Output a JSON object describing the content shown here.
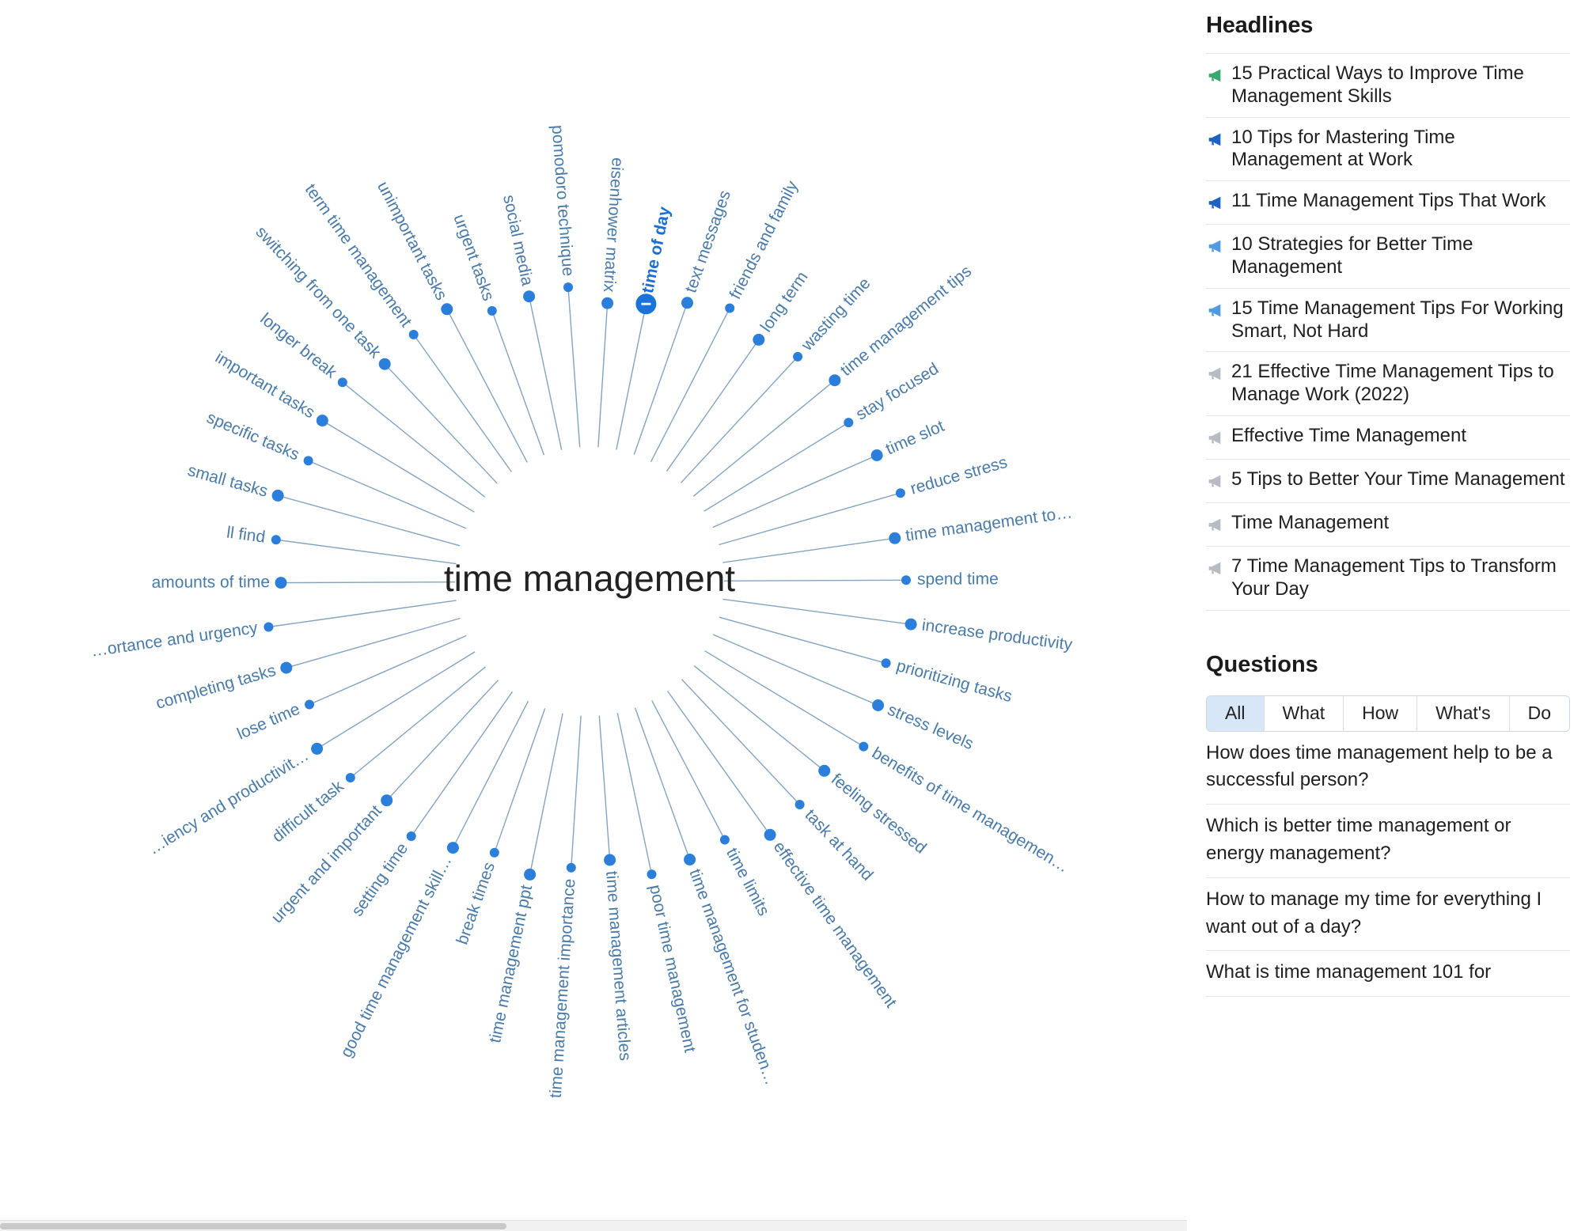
{
  "graph": {
    "center_label": "time management",
    "active_node": "time of day",
    "nodes": [
      {
        "label": "time of day",
        "angle": -77,
        "bold": true
      },
      {
        "label": "text messages",
        "angle": -65
      },
      {
        "label": "friends and family",
        "angle": -54
      },
      {
        "label": "long term",
        "angle": -44
      },
      {
        "label": "wasting time",
        "angle": -35
      },
      {
        "label": "time management tips",
        "angle": -26
      },
      {
        "label": "stay focused",
        "angle": -17
      },
      {
        "label": "time slot",
        "angle": -8
      },
      {
        "label": "reduce stress",
        "angle": 0
      },
      {
        "label": "time management to…",
        "angle": 8
      },
      {
        "label": "spend time",
        "angle": 17
      },
      {
        "label": "increase productivity",
        "angle": 26
      },
      {
        "label": "prioritizing tasks",
        "angle": 35
      },
      {
        "label": "stress levels",
        "angle": 44
      },
      {
        "label": "benefits of time managemen…",
        "angle": 54
      },
      {
        "label": "feeling stressed",
        "angle": 63
      },
      {
        "label": "task at hand",
        "angle": 71
      },
      {
        "label": "effective time management",
        "angle": 79
      },
      {
        "label": "time limits",
        "angle": 87
      },
      {
        "label": "time management for studen…",
        "angle": 95
      },
      {
        "label": "poor time management",
        "angle": 103
      },
      {
        "label": "time management articles",
        "angle": 111
      },
      {
        "label": "time management importance",
        "angle": 119
      },
      {
        "label": "time management ppt",
        "angle": 127
      },
      {
        "label": "break times",
        "angle": 135
      },
      {
        "label": "good time management skill…",
        "angle": 143
      },
      {
        "label": "setting time",
        "angle": 152
      },
      {
        "label": "urgent and important",
        "angle": 161
      },
      {
        "label": "difficult task",
        "angle": 170
      },
      {
        "label": "…iency and productivit…",
        "angle": 179
      },
      {
        "label": "lose time",
        "angle": 188
      },
      {
        "label": "completing tasks",
        "angle": 180
      },
      {
        "label": "…ortance and urgency",
        "angle": 193
      },
      {
        "label": "amounts of time",
        "angle": 201
      },
      {
        "label": "ll find",
        "angle": 209
      },
      {
        "label": "small tasks",
        "angle": 217
      },
      {
        "label": "specific tasks",
        "angle": 225
      },
      {
        "label": "important tasks",
        "angle": 233
      },
      {
        "label": "longer break",
        "angle": 241
      },
      {
        "label": "switching from one task",
        "angle": 249
      },
      {
        "label": "term time management",
        "angle": 257
      },
      {
        "label": "unimportant tasks",
        "angle": 265
      },
      {
        "label": "urgent tasks",
        "angle": 273
      },
      {
        "label": "social media",
        "angle": 281
      },
      {
        "label": "pomodoro technique",
        "angle": 289
      },
      {
        "label": "eisenhower matrix",
        "angle": 297
      }
    ]
  },
  "sidebar": {
    "headlines_title": "Headlines",
    "headlines": [
      {
        "text": "15 Practical Ways to Improve Time Management Skills",
        "icon": "megaphone-icon",
        "color": "#3aa76d"
      },
      {
        "text": "10 Tips for Mastering Time Management at Work",
        "icon": "megaphone-icon",
        "color": "#1b63c4"
      },
      {
        "text": "11 Time Management Tips That Work",
        "icon": "megaphone-icon",
        "color": "#1b63c4"
      },
      {
        "text": "10 Strategies for Better Time Management",
        "icon": "megaphone-icon",
        "color": "#4f9ae0"
      },
      {
        "text": "15 Time Management Tips For Working Smart, Not Hard",
        "icon": "megaphone-icon",
        "color": "#4f9ae0"
      },
      {
        "text": "21 Effective Time Management Tips to Manage Work (2022)",
        "icon": "megaphone-icon",
        "color": "#b6bcc2"
      },
      {
        "text": "Effective Time Management",
        "icon": "megaphone-icon",
        "color": "#b6bcc2"
      },
      {
        "text": "5 Tips to Better Your Time Management",
        "icon": "megaphone-icon",
        "color": "#b6bcc2"
      },
      {
        "text": "Time Management",
        "icon": "megaphone-icon",
        "color": "#b6bcc2"
      },
      {
        "text": "7 Time Management Tips to Transform Your Day",
        "icon": "megaphone-icon",
        "color": "#b6bcc2"
      }
    ],
    "questions_title": "Questions",
    "question_tabs": [
      {
        "label": "All",
        "active": true
      },
      {
        "label": "What",
        "active": false
      },
      {
        "label": "How",
        "active": false
      },
      {
        "label": "What's",
        "active": false
      },
      {
        "label": "Do",
        "active": false
      }
    ],
    "questions": [
      "How does time management help to be a successful person?",
      "Which is better time management or energy management?",
      "How to manage my time for everything I want out of a day?",
      "What is time management 101 for"
    ]
  },
  "colors": {
    "node": "#2b7fdb",
    "label": "#4a7ba8",
    "spoke": "#6f93b5",
    "center_text": "#222222",
    "tab_active_bg": "#d8e7f7"
  }
}
